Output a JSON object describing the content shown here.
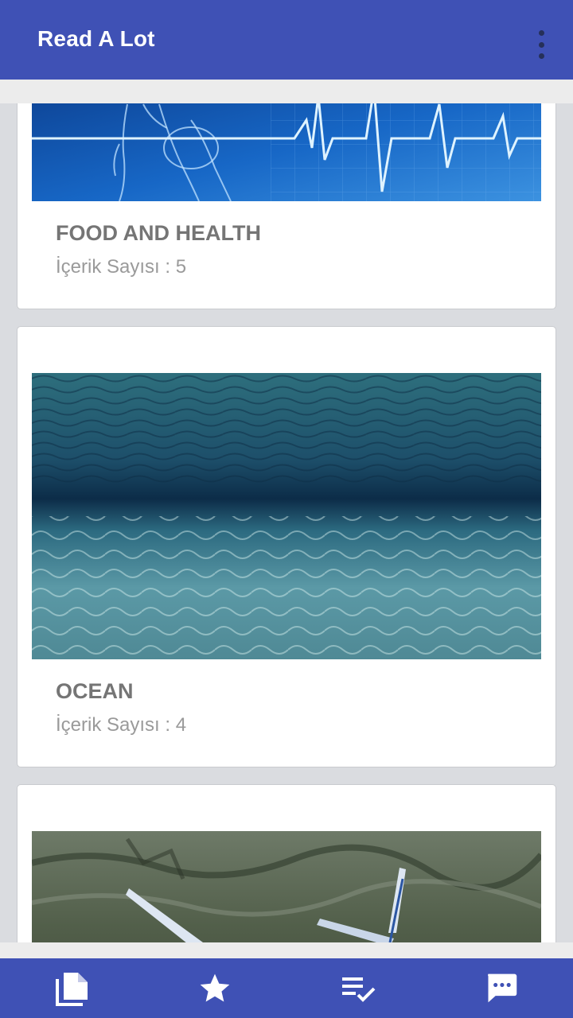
{
  "app_bar": {
    "title": "Read A Lot",
    "menu_icon": "more-vert-icon"
  },
  "categories": [
    {
      "title": "FOOD AND HEALTH",
      "count_label": "İçerik Sayısı : 5",
      "image": "blue-medical-body-heartbeat-image"
    },
    {
      "title": "OCEAN",
      "count_label": "İçerik Sayısı : 4",
      "image": "underwater-ocean-image"
    },
    {
      "title": "",
      "count_label": "",
      "image": "aerial-airplane-mountains-image"
    }
  ],
  "bottom_nav": {
    "items": [
      {
        "icon": "documents-icon"
      },
      {
        "icon": "star-icon"
      },
      {
        "icon": "playlist-check-icon"
      },
      {
        "icon": "chat-icon"
      }
    ]
  },
  "colors": {
    "primary": "#3f51b5",
    "background": "#dadce0",
    "card": "#ffffff",
    "title_text": "#757575",
    "count_text": "#9a9a9a"
  }
}
